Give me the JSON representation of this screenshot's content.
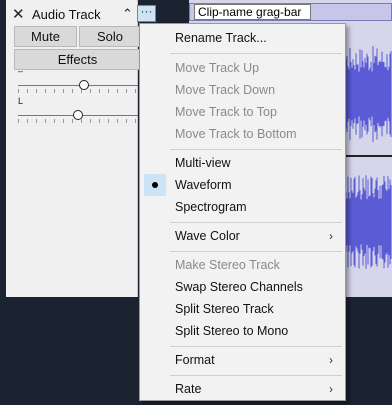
{
  "track": {
    "name": "Audio Track",
    "close_icon": "close-icon",
    "collapse_icon": "chevron-up-icon",
    "menu_icon": "ellipsis-icon",
    "menu_glyph": "···",
    "close_glyph": "✕",
    "collapse_glyph": "⌃",
    "mute_label": "Mute",
    "solo_label": "Solo",
    "effects_label": "Effects",
    "gain_label": "–",
    "pan_label": "L",
    "gain_level": 0.55,
    "pan_level": 0.5
  },
  "clip": {
    "name_value": "Clip-name grag-bar",
    "header_color": "#c7c6ea",
    "wave_color": "#5b5bd6"
  },
  "context_menu": {
    "items": [
      {
        "label": "Rename Track...",
        "enabled": true
      },
      {
        "label": "Move Track Up",
        "enabled": false
      },
      {
        "label": "Move Track Down",
        "enabled": false
      },
      {
        "label": "Move Track to Top",
        "enabled": false
      },
      {
        "label": "Move Track to Bottom",
        "enabled": false
      },
      {
        "label": "Multi-view",
        "enabled": true
      },
      {
        "label": "Waveform",
        "enabled": true,
        "selected": true
      },
      {
        "label": "Spectrogram",
        "enabled": true
      },
      {
        "label": "Wave Color",
        "enabled": true,
        "submenu": true
      },
      {
        "label": "Make Stereo Track",
        "enabled": false
      },
      {
        "label": "Swap Stereo Channels",
        "enabled": true
      },
      {
        "label": "Split Stereo Track",
        "enabled": true
      },
      {
        "label": "Split Stereo to Mono",
        "enabled": true
      },
      {
        "label": "Format",
        "enabled": true,
        "submenu": true
      },
      {
        "label": "Rate",
        "enabled": true,
        "submenu": true
      }
    ],
    "submenu_glyph": "›"
  }
}
